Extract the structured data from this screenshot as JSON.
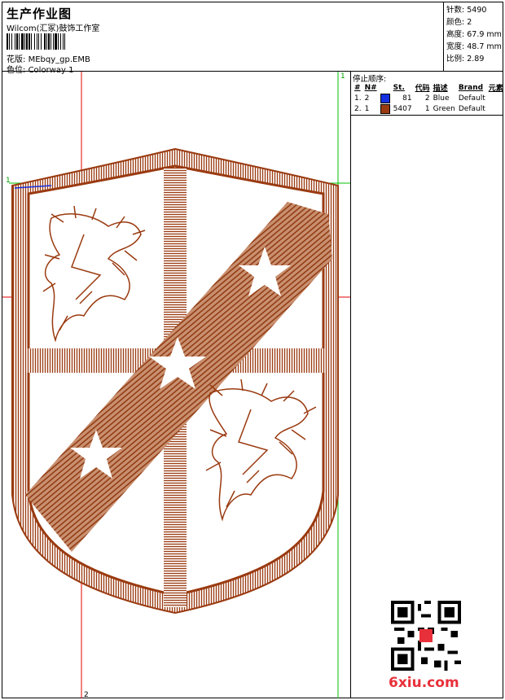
{
  "header": {
    "title": "生产作业图",
    "subtitle": "Wilcom(汇冢)鼓饰工作室",
    "design_label": "花版:",
    "design_file": "MEbqy_gp.EMB",
    "colorway_label": "色位:",
    "colorway": "Colorway 1"
  },
  "stats": {
    "stitches_label": "针数:",
    "stitches": "5490",
    "colors_label": "颜色:",
    "colors": "2",
    "height_label": "高度:",
    "height": "67.9 mm",
    "width_label": "宽度:",
    "width": "48.7 mm",
    "ratio_label": "比例:",
    "ratio": "2.89"
  },
  "stop_sequence": {
    "title": "停止顺序:",
    "columns": [
      "#",
      "N#",
      "St.",
      "代码",
      "描述",
      "Brand",
      "元素"
    ],
    "rows": [
      {
        "num": "1.",
        "n": "2",
        "color": "#1530e0",
        "st": "81",
        "code": "2",
        "desc": "Blue",
        "brand": "Default"
      },
      {
        "num": "2.",
        "n": "1",
        "color": "#9a3a10",
        "st": "5407",
        "code": "1",
        "desc": "Green",
        "brand": "Default"
      }
    ]
  },
  "canvas": {
    "marker_top": "1",
    "marker_left": "1",
    "marker_bottom": "2",
    "thread_color": "#9a3a10",
    "guide_red": "#e00000",
    "guide_green": "#00c000"
  },
  "watermark": {
    "logo": "6xiu.com"
  }
}
